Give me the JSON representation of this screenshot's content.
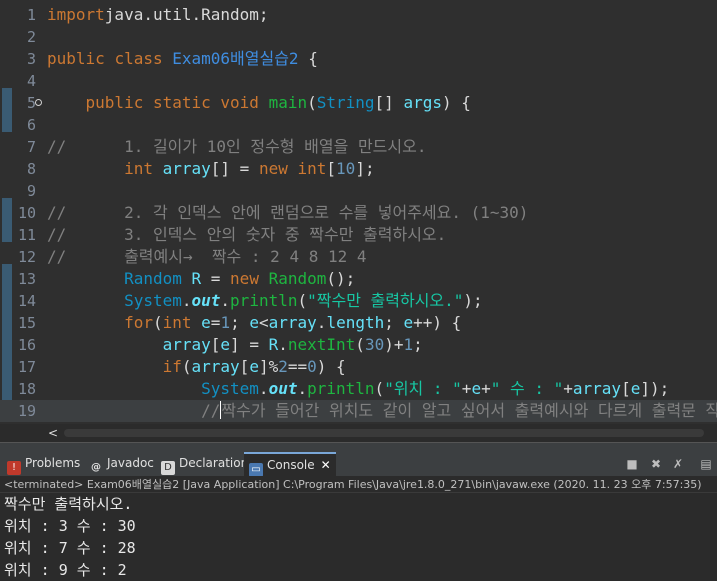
{
  "editor": {
    "lines": [
      {
        "n": "1",
        "segs": [
          [
            "kw",
            "import"
          ],
          [
            "",
            "java.util.Random;"
          ]
        ]
      },
      {
        "n": "2",
        "segs": []
      },
      {
        "n": "3",
        "segs": [
          [
            "kw",
            "public"
          ],
          [
            "",
            " "
          ],
          [
            "kw",
            "class"
          ],
          [
            "",
            " "
          ],
          [
            "cls",
            "Exam06배열실습2"
          ],
          [
            "",
            " {"
          ]
        ]
      },
      {
        "n": "4",
        "segs": []
      },
      {
        "n": "5",
        "segs": [
          [
            "",
            "    "
          ],
          [
            "kw",
            "public"
          ],
          [
            "",
            " "
          ],
          [
            "kw",
            "static"
          ],
          [
            "",
            " "
          ],
          [
            "kw",
            "void"
          ],
          [
            "",
            " "
          ],
          [
            "mth",
            "main"
          ],
          [
            "",
            "("
          ],
          [
            "tp",
            "String"
          ],
          [
            "",
            "[] "
          ],
          [
            "fld",
            "args"
          ],
          [
            "",
            ") {"
          ]
        ]
      },
      {
        "n": "6",
        "segs": []
      },
      {
        "n": "7",
        "segs": [
          [
            "cmt",
            "//      1. 길이가 10인 정수형 배열을 만드시오."
          ]
        ]
      },
      {
        "n": "8",
        "segs": [
          [
            "",
            "        "
          ],
          [
            "kw",
            "int"
          ],
          [
            "",
            " "
          ],
          [
            "fld",
            "array"
          ],
          [
            "",
            "[] = "
          ],
          [
            "kw",
            "new"
          ],
          [
            "",
            " "
          ],
          [
            "kw",
            "int"
          ],
          [
            "",
            "["
          ],
          [
            "num",
            "10"
          ],
          [
            "",
            "];"
          ]
        ]
      },
      {
        "n": "9",
        "segs": []
      },
      {
        "n": "10",
        "segs": [
          [
            "cmt",
            "//      2. 각 인덱스 안에 랜덤으로 수를 넣어주세요. (1~30)"
          ]
        ]
      },
      {
        "n": "11",
        "segs": [
          [
            "cmt",
            "//      3. 인덱스 안의 숫자 중 짝수만 출력하시오."
          ]
        ]
      },
      {
        "n": "12",
        "segs": [
          [
            "cmt",
            "//      출력예시→  짝수 : 2 4 8 12 4"
          ]
        ]
      },
      {
        "n": "13",
        "segs": [
          [
            "",
            "        "
          ],
          [
            "tp",
            "Random"
          ],
          [
            "",
            " "
          ],
          [
            "fld",
            "R"
          ],
          [
            "",
            " = "
          ],
          [
            "kw",
            "new"
          ],
          [
            "",
            " "
          ],
          [
            "mth",
            "Random"
          ],
          [
            "",
            "();"
          ]
        ]
      },
      {
        "n": "14",
        "segs": [
          [
            "",
            "        "
          ],
          [
            "tp",
            "System"
          ],
          [
            "",
            "."
          ],
          [
            "fld ital",
            "out"
          ],
          [
            "",
            "."
          ],
          [
            "mth",
            "println"
          ],
          [
            "",
            "("
          ],
          [
            "str",
            "\"짝수만 출력하시오.\""
          ],
          [
            "",
            ");"
          ]
        ]
      },
      {
        "n": "15",
        "segs": [
          [
            "",
            "        "
          ],
          [
            "kw",
            "for"
          ],
          [
            "",
            "("
          ],
          [
            "kw",
            "int"
          ],
          [
            "",
            " "
          ],
          [
            "fld",
            "e"
          ],
          [
            "",
            "="
          ],
          [
            "num",
            "1"
          ],
          [
            "",
            "; "
          ],
          [
            "fld",
            "e"
          ],
          [
            "",
            "<"
          ],
          [
            "fld",
            "array"
          ],
          [
            "",
            "."
          ],
          [
            "fld",
            "length"
          ],
          [
            "",
            "; "
          ],
          [
            "fld",
            "e"
          ],
          [
            "",
            "++) {"
          ]
        ]
      },
      {
        "n": "16",
        "segs": [
          [
            "",
            "            "
          ],
          [
            "fld",
            "array"
          ],
          [
            "",
            "["
          ],
          [
            "fld",
            "e"
          ],
          [
            "",
            "] = "
          ],
          [
            "fld",
            "R"
          ],
          [
            "",
            "."
          ],
          [
            "mth",
            "nextInt"
          ],
          [
            "",
            "("
          ],
          [
            "num",
            "30"
          ],
          [
            "",
            ")+"
          ],
          [
            "num",
            "1"
          ],
          [
            "",
            ";"
          ]
        ]
      },
      {
        "n": "17",
        "segs": [
          [
            "",
            "            "
          ],
          [
            "kw",
            "if"
          ],
          [
            "",
            "("
          ],
          [
            "fld",
            "array"
          ],
          [
            "",
            "["
          ],
          [
            "fld",
            "e"
          ],
          [
            "",
            "]%"
          ],
          [
            "num",
            "2"
          ],
          [
            "",
            "=="
          ],
          [
            "num",
            "0"
          ],
          [
            "",
            ") {"
          ]
        ]
      },
      {
        "n": "18",
        "segs": [
          [
            "",
            "                "
          ],
          [
            "tp",
            "System"
          ],
          [
            "",
            "."
          ],
          [
            "fld ital",
            "out"
          ],
          [
            "",
            "."
          ],
          [
            "mth",
            "println"
          ],
          [
            "",
            "("
          ],
          [
            "str",
            "\"위치 : \""
          ],
          [
            "",
            "+"
          ],
          [
            "fld",
            "e"
          ],
          [
            "",
            "+"
          ],
          [
            "str",
            "\" 수 : \""
          ],
          [
            "",
            "+"
          ],
          [
            "fld",
            "array"
          ],
          [
            "",
            "["
          ],
          [
            "fld",
            "e"
          ],
          [
            "",
            "]);"
          ]
        ]
      },
      {
        "n": "19",
        "segs": [
          [
            "",
            "                "
          ],
          [
            "cmt",
            "//"
          ],
          [
            "caret",
            ""
          ],
          [
            "cmt",
            "짝수가 들어간 위치도 같이 알고 싶어서 출력예시와 다르게 출력문 작성"
          ]
        ]
      }
    ],
    "fold_marker_line": "5",
    "hscroll_left_arrow": "<"
  },
  "views": {
    "tabs": [
      {
        "label": "Problems",
        "icon": "problems-icon"
      },
      {
        "label": "Javadoc",
        "icon": "javadoc-icon"
      },
      {
        "label": "Declaration",
        "icon": "declaration-icon"
      },
      {
        "label": "Console",
        "icon": "console-icon",
        "active": true,
        "close": "✕"
      }
    ],
    "toolbar": [
      "stop-icon",
      "remove-launch-icon",
      "remove-all-icon",
      "display-console-icon"
    ]
  },
  "console": {
    "header": "<terminated> Exam06배열실습2 [Java Application] C:\\Program Files\\Java\\jre1.8.0_271\\bin\\javaw.exe  (2020. 11. 23 오후 7:57:35)",
    "output": [
      "짝수만 출력하시오.",
      "위치 : 3 수 : 30",
      "위치 : 7 수 : 28",
      "위치 : 9 수 : 2"
    ]
  },
  "colors": {
    "keyword": "#cc7832",
    "string": "#17c6a3",
    "comment": "#808080",
    "method": "#1eb540",
    "field": "#66e1f8",
    "type": "#1290c3"
  }
}
